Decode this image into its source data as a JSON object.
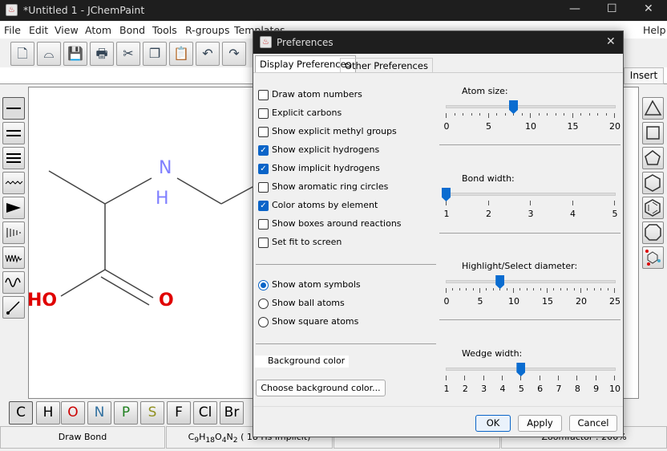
{
  "window": {
    "title": "*Untitled 1 - JChemPaint",
    "min": "—",
    "max": "☐",
    "close": "✕"
  },
  "menu": [
    "File",
    "Edit",
    "View",
    "Atom",
    "Bond",
    "Tools",
    "R-groups",
    "Templates",
    "Help"
  ],
  "toolbar": [
    "new-icon",
    "open-icon",
    "save-icon",
    "print-icon",
    "cut-icon",
    "copy-icon",
    "paste-icon",
    "undo-icon",
    "redo-icon"
  ],
  "insert_label": "Insert",
  "molecule": {
    "atoms": [
      {
        "label": "N",
        "color": "#8080ff"
      },
      {
        "label": "H",
        "color": "#8080ff"
      },
      {
        "label": "HO",
        "color": "#e00000"
      },
      {
        "label": "O",
        "color": "#e00000"
      }
    ]
  },
  "elements": [
    {
      "s": "C",
      "c": "#000000"
    },
    {
      "s": "H",
      "c": "#000000"
    },
    {
      "s": "O",
      "c": "#cc0000"
    },
    {
      "s": "N",
      "c": "#3070a0"
    },
    {
      "s": "P",
      "c": "#208020"
    },
    {
      "s": "S",
      "c": "#909020"
    },
    {
      "s": "F",
      "c": "#000000"
    },
    {
      "s": "Cl",
      "c": "#000000"
    },
    {
      "s": "Br",
      "c": "#000000"
    }
  ],
  "status": {
    "mode": "Draw Bond",
    "formula": {
      "c": "C",
      "cn": "9",
      "h": "H",
      "hn": "18",
      "o": "O",
      "on": "4",
      "n": "N",
      "nn": "2",
      "rest": " ( 18 Hs implicit)"
    },
    "zoom": "Zoomfactor : 206%"
  },
  "dialog": {
    "title": "Preferences",
    "close": "✕",
    "tabs": [
      "Display Preferences",
      "Other Preferences"
    ],
    "checkboxes": [
      {
        "label": "Draw atom numbers",
        "checked": false
      },
      {
        "label": "Explicit carbons",
        "checked": false
      },
      {
        "label": "Show explicit methyl groups",
        "checked": false
      },
      {
        "label": "Show explicit hydrogens",
        "checked": true
      },
      {
        "label": "Show implicit hydrogens",
        "checked": true
      },
      {
        "label": "Show aromatic ring circles",
        "checked": false
      },
      {
        "label": "Color atoms by element",
        "checked": true
      },
      {
        "label": "Show boxes around reactions",
        "checked": false
      },
      {
        "label": "Set fit to screen",
        "checked": false
      }
    ],
    "radios": [
      {
        "label": "Show atom symbols",
        "selected": true
      },
      {
        "label": "Show ball atoms",
        "selected": false
      },
      {
        "label": "Show square atoms",
        "selected": false
      }
    ],
    "background_label": "Background color",
    "choose_bg": "Choose background color...",
    "sliders": [
      {
        "label": "Atom size:",
        "min": 0,
        "max": 20,
        "value": 8,
        "labels": [
          "0",
          "5",
          "10",
          "15",
          "20"
        ],
        "minor": 1
      },
      {
        "label": "Bond width:",
        "min": 1,
        "max": 5,
        "value": 1,
        "labels": [
          "1",
          "2",
          "3",
          "4",
          "5"
        ],
        "minor": 1
      },
      {
        "label": "Highlight/Select diameter:",
        "min": 0,
        "max": 25,
        "value": 8,
        "labels": [
          "0",
          "5",
          "10",
          "15",
          "20",
          "25"
        ],
        "minor": 1
      },
      {
        "label": "Wedge width:",
        "min": 1,
        "max": 10,
        "value": 5,
        "labels": [
          "1",
          "2",
          "3",
          "4",
          "5",
          "6",
          "7",
          "8",
          "9",
          "10"
        ],
        "minor": 1
      }
    ],
    "ok": "OK",
    "apply": "Apply",
    "cancel": "Cancel"
  }
}
